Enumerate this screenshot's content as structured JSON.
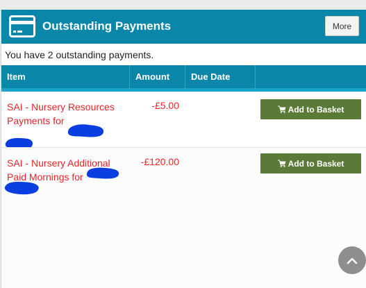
{
  "panel": {
    "title": "Outstanding Payments",
    "icon": "credit-card-icon",
    "more_label": "More"
  },
  "summary": "You have 2 outstanding payments.",
  "table": {
    "columns": [
      "Item",
      "Amount",
      "Due Date",
      ""
    ],
    "rows": [
      {
        "item": "SAI - Nursery Resources Payments for",
        "amount": "-£5.00",
        "due_date": "",
        "action_label": "Add to Basket",
        "action_icon": "shopping-cart-icon"
      },
      {
        "item": "SAI - Nursery Additional Paid Mornings for",
        "amount": "-£120.00",
        "due_date": "",
        "action_label": "Add to Basket",
        "action_icon": "shopping-cart-icon"
      }
    ]
  },
  "scroll_top_icon": "chevron-up-icon",
  "colors": {
    "header": "#0a86a8",
    "item_text": "#e8242a",
    "action_button": "#5c7a37",
    "redaction": "#0a3ee0"
  }
}
